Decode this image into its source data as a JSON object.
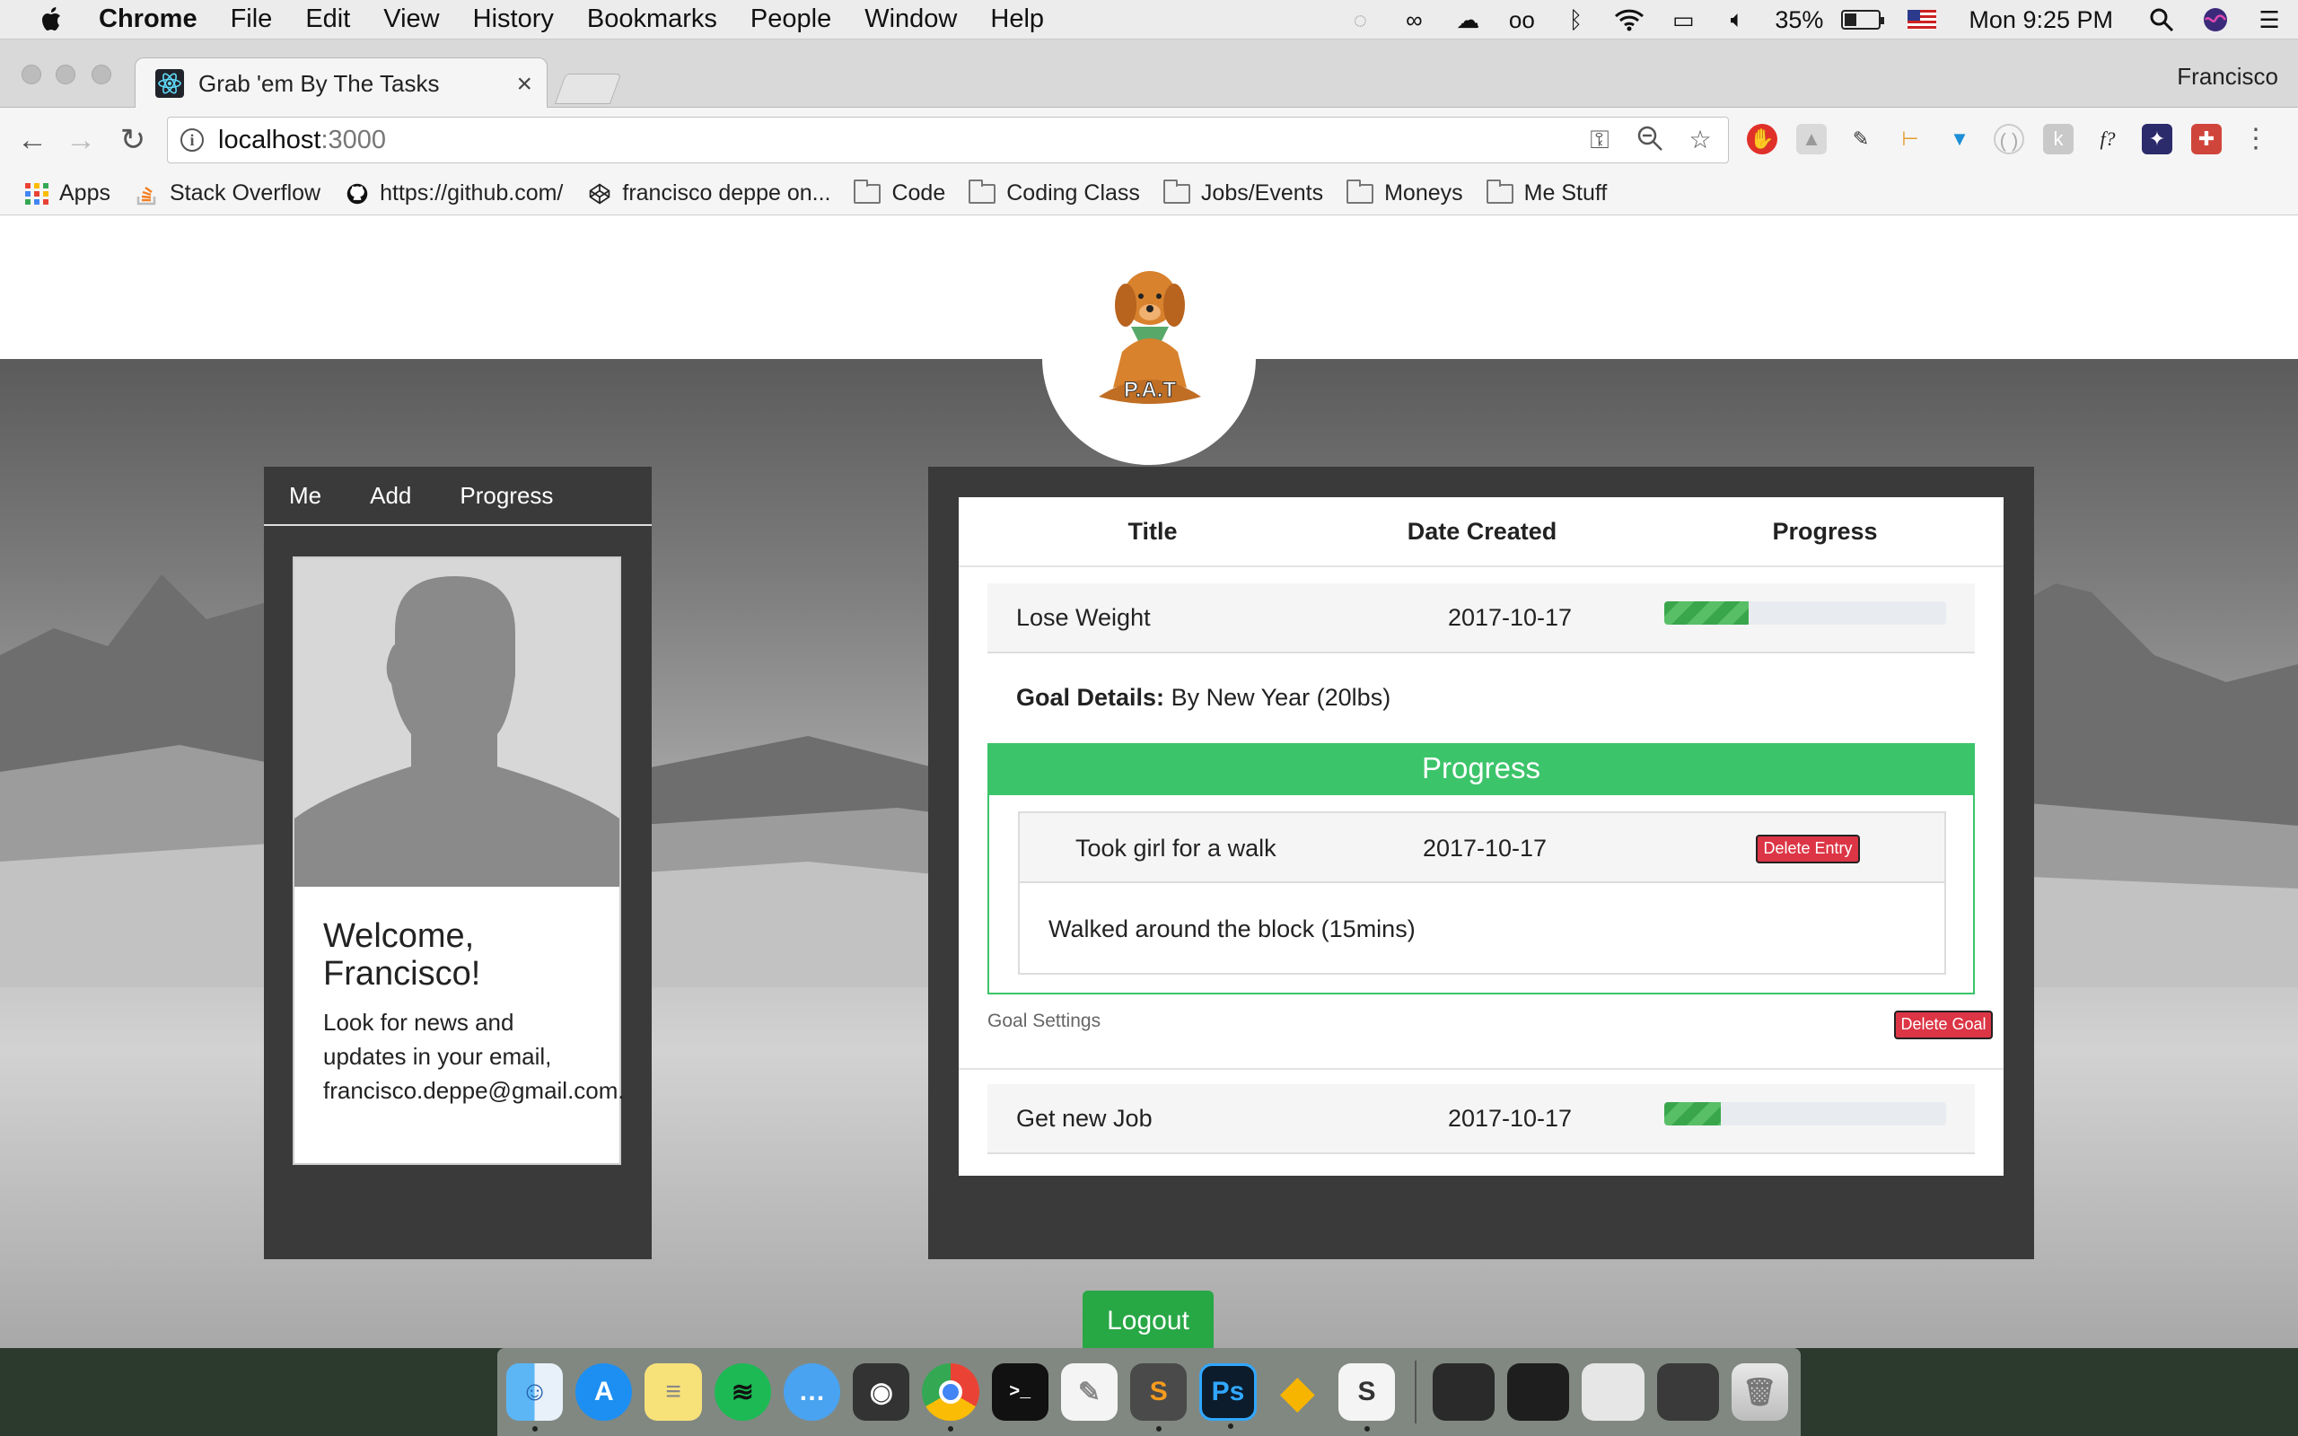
{
  "menubar": {
    "app_name": "Chrome",
    "menus": [
      "File",
      "Edit",
      "View",
      "History",
      "Bookmarks",
      "People",
      "Window",
      "Help"
    ],
    "battery_percent": "35%",
    "clock": "Mon 9:25 PM",
    "battery_level": 0.35
  },
  "browser": {
    "tab_title": "Grab 'em By The Tasks",
    "tab_close": "×",
    "profile": "Francisco",
    "url_host": "localhost",
    "url_port": ":3000",
    "bookmarks": {
      "apps": "Apps",
      "stack_overflow": "Stack Overflow",
      "github": "https://github.com/",
      "codepen": "francisco deppe on...",
      "folders": [
        "Code",
        "Coding Class",
        "Jobs/Events",
        "Moneys",
        "Me Stuff"
      ]
    }
  },
  "app": {
    "logo_text": "P.A.T",
    "sidebar": {
      "tabs": [
        "Me",
        "Add",
        "Progress"
      ],
      "welcome": "Welcome, Francisco!",
      "news": "Look for news and updates in your email, francisco.deppe@gmail.com."
    },
    "table": {
      "headers": [
        "Title",
        "Date Created",
        "Progress"
      ]
    },
    "goals": [
      {
        "title": "Lose Weight",
        "date": "2017-10-17",
        "progress": 0.3,
        "details_label": "Goal Details:",
        "details": "By New Year (20lbs)",
        "progress_panel_title": "Progress",
        "entries": [
          {
            "title": "Took girl for a walk",
            "date": "2017-10-17",
            "delete_label": "Delete Entry",
            "description": "Walked around the block (15mins)"
          }
        ],
        "settings_label": "Goal Settings",
        "delete_goal_label": "Delete Goal"
      },
      {
        "title": "Get new Job",
        "date": "2017-10-17",
        "progress": 0.2
      }
    ],
    "logout_label": "Logout"
  },
  "colors": {
    "accent_green": "#3cc46a",
    "danger_red": "#dc3545",
    "panel_dark": "#3a3a3a"
  },
  "dock": {
    "apps": [
      "finder-icon",
      "app-store-icon",
      "notes-icon",
      "spotify-icon",
      "messages-icon",
      "logic-icon",
      "chrome-icon",
      "terminal-icon",
      "textedit-icon",
      "sublime-icon",
      "photoshop-icon",
      "sketch-icon",
      "slack-icon",
      "trash-icon"
    ]
  }
}
